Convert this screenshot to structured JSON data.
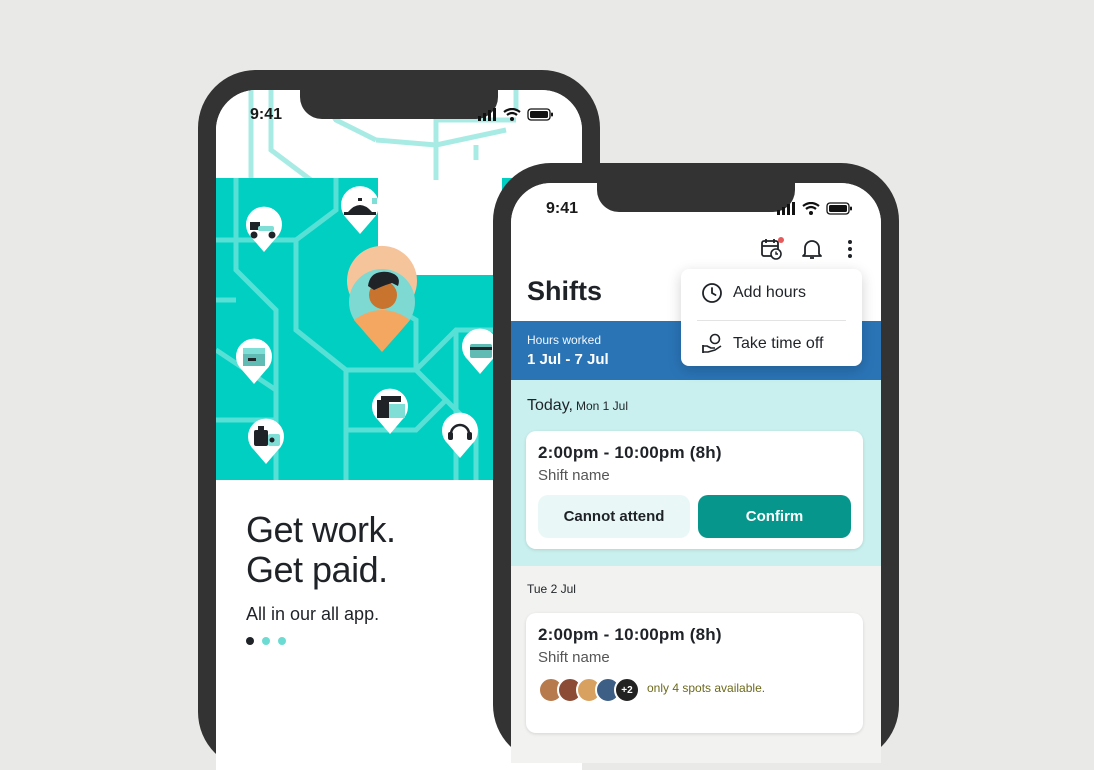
{
  "phone1": {
    "time": "9:41",
    "headline_line1": "Get work.",
    "headline_line2": "Get paid.",
    "subtitle": "All in our all app.",
    "carousel_active_index": 0,
    "carousel_count": 3
  },
  "phone2": {
    "time": "9:41",
    "title": "Shifts",
    "hours_worked_label": "Hours worked",
    "hours_worked_range": "1 Jul - 7 Jul",
    "menu": {
      "add_hours": "Add hours",
      "take_time_off": "Take time off"
    },
    "today": {
      "label": "Today,",
      "date": "Mon 1 Jul",
      "shift_time": "2:00pm - 10:00pm (8h)",
      "shift_name": "Shift name",
      "cannot_attend": "Cannot attend",
      "confirm": "Confirm"
    },
    "next_day": {
      "date": "Tue 2 Jul",
      "shift_time": "2:00pm - 10:00pm (8h)",
      "shift_name": "Shift name",
      "more_count": "+2",
      "spots_text": "only 4 spots available."
    }
  },
  "colors": {
    "teal": "#00cfc1",
    "brand_green": "#07968c",
    "blue_band": "#2a74b6",
    "light_teal": "#c9f0ee",
    "notification_dot": "#e55b5b"
  },
  "icons": [
    "signal-icon",
    "wifi-icon",
    "battery-icon",
    "scooter-icon",
    "food-tray-icon",
    "box-icon",
    "card-icon",
    "store-icon",
    "luggage-icon",
    "headset-icon",
    "calendar-clock-icon",
    "bell-icon",
    "more-vertical-icon",
    "clock-icon",
    "hand-money-icon"
  ]
}
